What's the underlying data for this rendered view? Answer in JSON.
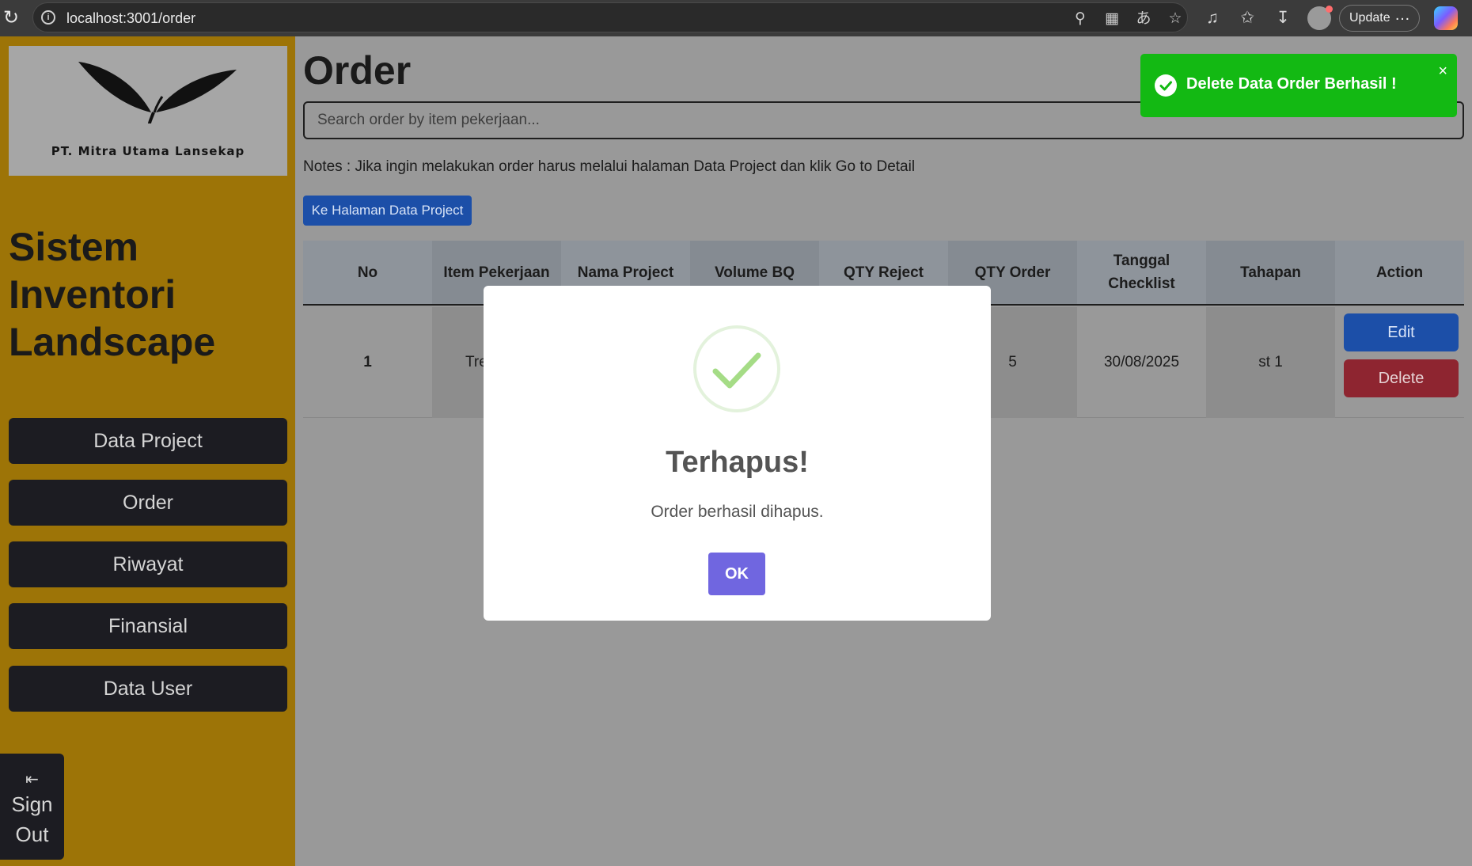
{
  "browser": {
    "url": "localhost:3001/order",
    "update_label": "Update",
    "more_label": "…"
  },
  "sidebar": {
    "company": "PT. Mitra Utama Lansekap",
    "app_title": "Sistem Inventori Landscape",
    "nav": [
      {
        "label": "Data Project"
      },
      {
        "label": "Order"
      },
      {
        "label": "Riwayat"
      },
      {
        "label": "Finansial"
      },
      {
        "label": "Data User"
      }
    ],
    "signout_line1": "Sign",
    "signout_line2": "Out"
  },
  "page": {
    "title": "Order",
    "search_placeholder": "Search order by item pekerjaan...",
    "notes": "Notes : Jika ingin melakukan order harus melalui halaman Data Project dan klik Go to Detail",
    "to_project_button": "Ke Halaman Data Project"
  },
  "table": {
    "headers": [
      {
        "line1": "No",
        "line2": ""
      },
      {
        "line1": "Item Pekerjaan",
        "line2": ""
      },
      {
        "line1": "Nama Project",
        "line2": ""
      },
      {
        "line1": "Volume BQ",
        "line2": ""
      },
      {
        "line1": "QTY Reject",
        "line2": ""
      },
      {
        "line1": "QTY Order",
        "line2": ""
      },
      {
        "line1": "Tanggal",
        "line2": "Checklist"
      },
      {
        "line1": "Tahapan",
        "line2": ""
      },
      {
        "line1": "Action",
        "line2": ""
      }
    ],
    "rows": [
      {
        "no": "1",
        "item_pekerjaan": "Tre",
        "nama_project": "",
        "volume_bq": "",
        "qty_reject": "",
        "qty_order": "5",
        "tanggal_checklist": "30/08/2025",
        "tahapan": "st 1",
        "edit_label": "Edit",
        "delete_label": "Delete"
      }
    ]
  },
  "modal": {
    "title": "Terhapus!",
    "text": "Order berhasil dihapus.",
    "ok_label": "OK"
  },
  "toast": {
    "text": "Delete Data Order Berhasil !",
    "close": "×"
  },
  "colors": {
    "sidebar_bg": "#9d7407",
    "toast_bg": "#13b913",
    "modal_ok": "#7066e0",
    "success_check": "#a5dc86",
    "edit_btn": "#1c4fa8",
    "delete_btn": "#8e2530"
  }
}
